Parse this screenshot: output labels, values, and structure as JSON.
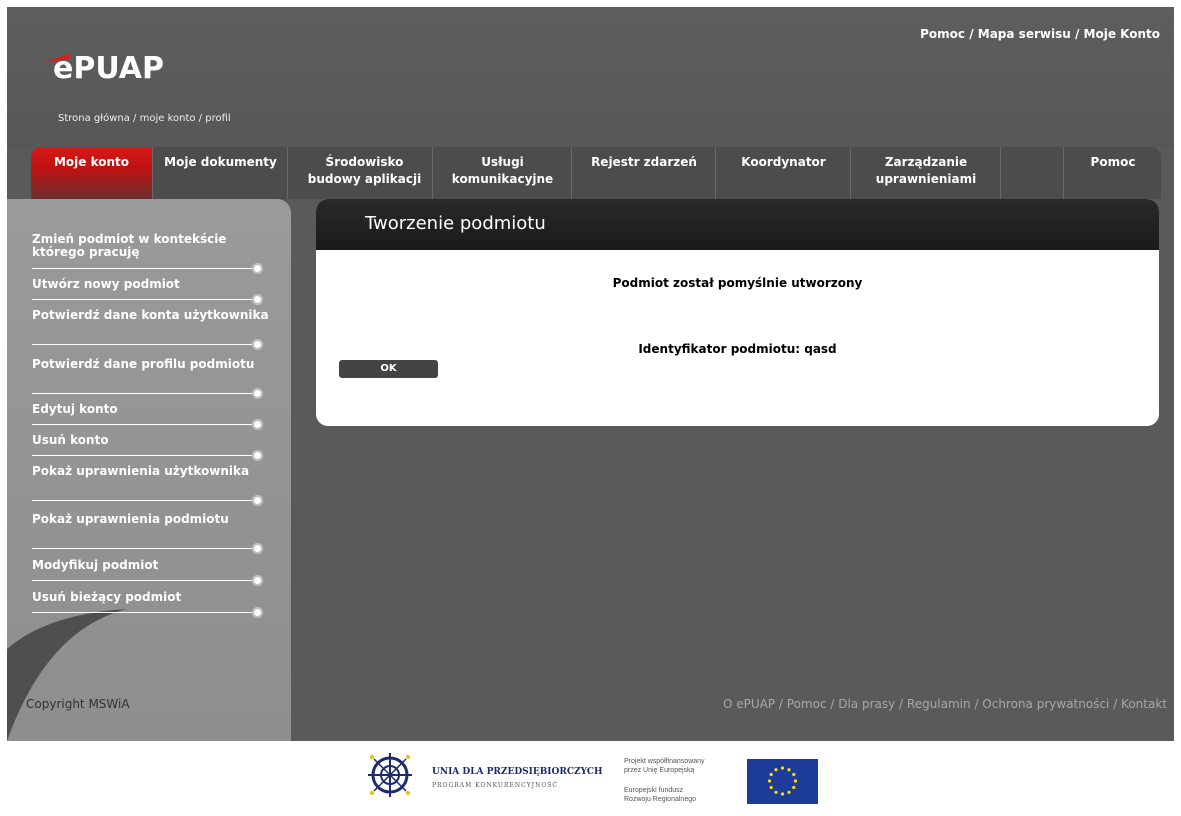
{
  "header": {
    "logo_text": "ePUAP",
    "breadcrumb": "Strona główna / moje konto  / profil",
    "top_links": [
      "Pomoc",
      "Mapa serwisu",
      "Moje Konto"
    ],
    "top_sep": " / "
  },
  "nav": {
    "tabs": [
      {
        "label": "Moje konto"
      },
      {
        "label": "Moje dokumenty"
      },
      {
        "label": "Środowisko\nbudowy aplikacji"
      },
      {
        "label": "Usługi\nkomunikacyjne"
      },
      {
        "label": "Rejestr zdarzeń"
      },
      {
        "label": "Koordynator"
      },
      {
        "label": "Zarządzanie\nuprawnieniami"
      },
      {
        "label": ""
      },
      {
        "label": "Pomoc"
      }
    ]
  },
  "sidebar": {
    "items": [
      {
        "label": "Zmień podmiot w kontekście którego pracuję"
      },
      {
        "label": "Utwórz nowy podmiot"
      },
      {
        "label": "Potwierdź dane konta użytkownika"
      },
      {
        "label": "Potwierdź dane profilu podmiotu"
      },
      {
        "label": "Edytuj konto"
      },
      {
        "label": "Usuń konto"
      },
      {
        "label": "Pokaż uprawnienia użytkownika"
      },
      {
        "label": "Pokaż uprawnienia podmiotu"
      },
      {
        "label": "Modyfikuj podmiot"
      },
      {
        "label": "Usuń bieżący podmiot"
      }
    ],
    "copyright": "Copyright MSWiA"
  },
  "content": {
    "title": "Tworzenie podmiotu",
    "success_message": "Podmiot został pomyślnie utworzony",
    "identifier_message": "Identyfikator podmiotu: qasd",
    "ok_label": "OK"
  },
  "footer": {
    "links_text": "O ePUAP / Pomoc / Dla prasy / Regulamin / Ochrona prywatności / Kontakt",
    "udp_title": "UNIA DLA PRZEDSIĘBIORCZYCH",
    "udp_subtitle": "PROGRAM KONKURENCYJNOŚĆ",
    "eu_line1": "Projekt współfinansowany",
    "eu_line2": "przez Unię Europejską",
    "eu_line3": "Europejski fundusz",
    "eu_line4": "Rozwoju Regionalnego"
  },
  "colors": {
    "accent_red": "#d41a1a",
    "background": "#5a5a5a",
    "sidebar": "#9a9a9a",
    "eu_blue": "#1d3c9a",
    "eu_star": "#ffdd00"
  }
}
